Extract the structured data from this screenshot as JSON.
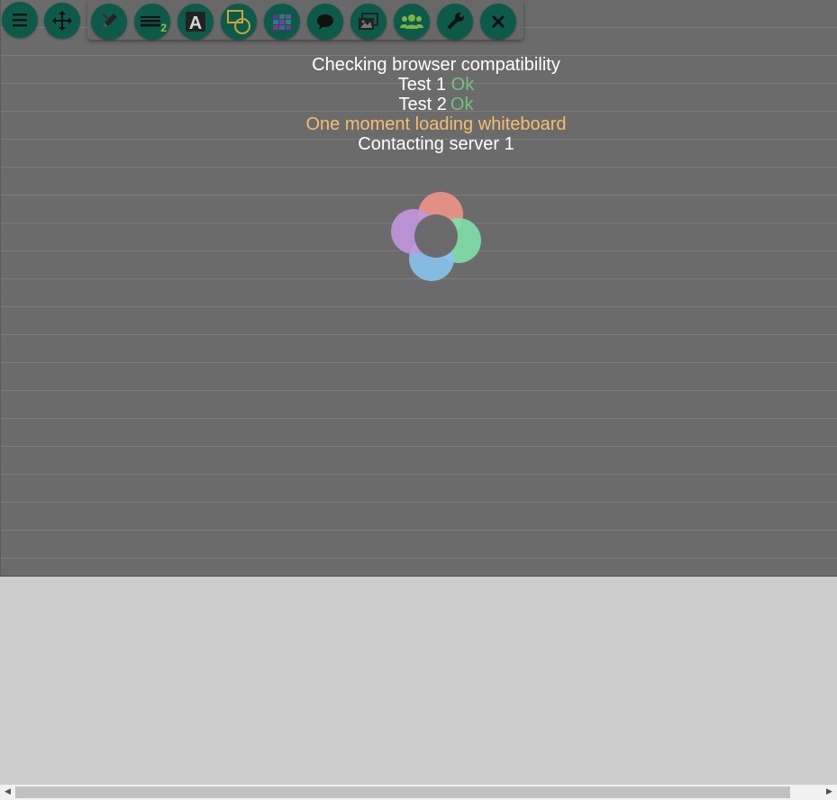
{
  "status": {
    "line1": "Checking browser compatibility",
    "test1_label": "Test 1",
    "test1_result": "Ok",
    "test2_label": "Test 2",
    "test2_result": "Ok",
    "loading": "One moment loading whiteboard",
    "server": "Contacting server 1"
  },
  "toolbar": {
    "line_width_badge": "2",
    "icons": [
      "menu-icon",
      "move-icon",
      "pencil-tools-icon",
      "line-width-icon",
      "text-icon",
      "shapes-icon",
      "color-palette-icon",
      "chat-icon",
      "images-icon",
      "users-icon",
      "settings-icon",
      "close-icon"
    ]
  },
  "colors": {
    "button_bg": "#0e5a4a",
    "ok": "#72c17c",
    "loading": "#f7bd6e",
    "petal_red": "#f0958a",
    "petal_green": "#7fe0a8",
    "petal_blue": "#8ac4ee",
    "petal_purple": "#c197de"
  }
}
